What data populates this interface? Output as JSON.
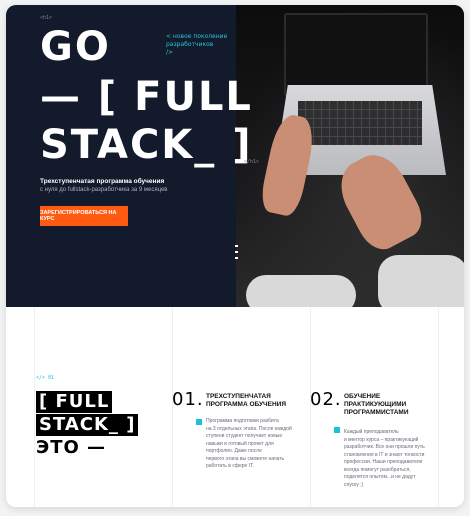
{
  "hero": {
    "tag_open": "<h1>",
    "title_line1": "GO",
    "title_line2": "— [ FULL",
    "title_line3": "STACK_ ]",
    "tag_close": "</h1>",
    "comment_line1": "< новое поколение",
    "comment_line2": "разработчиков",
    "comment_line3": "/>",
    "subhead": "Трехступенчатая программа обучения",
    "subline": "с нуля до fullstack-разработчика за 9 месяцев",
    "cta_label": "Зарегистрироваться на курс"
  },
  "about": {
    "section_tag": "</> 01",
    "title_line1": "[ FULL",
    "title_line2": "STACK_ ]",
    "title_line3": "ЭТО —",
    "steps": [
      {
        "number": "01.",
        "title_line1": "Трехступенчатая",
        "title_line2": "программа обучения",
        "body_lines": [
          "Программа подготовки разбита",
          "на 3 отдельных этапа. После каждой",
          "ступени студент получает новые",
          "навыки и готовый проект для",
          "портфолио. Даже после",
          "первого этапа вы сможете начать",
          "работать в сфере IT."
        ]
      },
      {
        "number": "02.",
        "title_line1": "Обучение",
        "title_line2": "практикующими",
        "title_line3": "программистами",
        "body_lines": [
          "Каждый преподаватель",
          "и ментор курса – практикующий",
          "разработчик. Все они прошли путь",
          "становления в IT и знают тонкости",
          "профессии. Наши преподаватели",
          "всегда помогут разобраться,",
          "поделятся опытом...и не дадут",
          "спуску ;)"
        ]
      }
    ]
  },
  "colors": {
    "hero_bg": "#121a2b",
    "accent_cyan": "#19c2d8",
    "accent_orange": "#ff5a12"
  }
}
